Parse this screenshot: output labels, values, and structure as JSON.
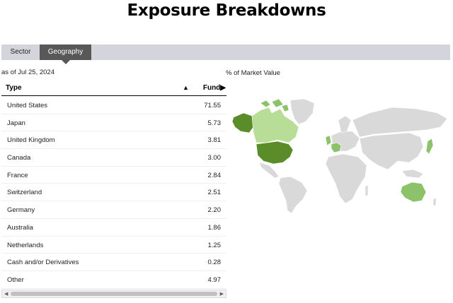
{
  "title": "Exposure Breakdowns",
  "tabs": [
    {
      "label": "Sector",
      "active": false
    },
    {
      "label": "Geography",
      "active": true
    }
  ],
  "as_of": "as of Jul 25, 2024",
  "map_label": "% of Market Value",
  "table": {
    "columns": [
      "Type",
      "Fund"
    ],
    "sort_icon": "▲",
    "fund_arrow": "▶",
    "rows": [
      {
        "type": "United States",
        "fund": "71.55"
      },
      {
        "type": "Japan",
        "fund": "5.73"
      },
      {
        "type": "United Kingdom",
        "fund": "3.81"
      },
      {
        "type": "Canada",
        "fund": "3.00"
      },
      {
        "type": "France",
        "fund": "2.84"
      },
      {
        "type": "Switzerland",
        "fund": "2.51"
      },
      {
        "type": "Germany",
        "fund": "2.20"
      },
      {
        "type": "Australia",
        "fund": "1.86"
      },
      {
        "type": "Netherlands",
        "fund": "1.25"
      },
      {
        "type": "Cash and/or Derivatives",
        "fund": "0.28"
      },
      {
        "type": "Other",
        "fund": "4.97"
      }
    ]
  },
  "colors": {
    "tab_active": "#585858",
    "tabbar": "#d4d4dc",
    "map_base": "#d9d9d9",
    "map_high": "#5b8c2a",
    "map_mid": "#8cc36a",
    "map_low": "#b7dd96"
  }
}
